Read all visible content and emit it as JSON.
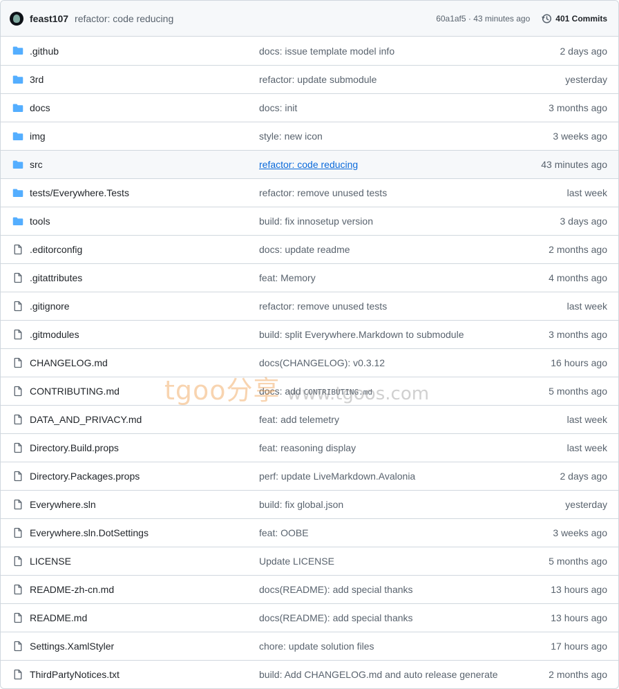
{
  "header": {
    "author": "feast107",
    "message": "refactor: code reducing",
    "meta": "60a1af5 · 43 minutes ago",
    "commits": "401 Commits"
  },
  "rows": [
    {
      "type": "folder",
      "name": ".github",
      "message": "docs: issue template model info",
      "time": "2 days ago"
    },
    {
      "type": "folder",
      "name": "3rd",
      "message": "refactor: update submodule",
      "time": "yesterday"
    },
    {
      "type": "folder",
      "name": "docs",
      "message": "docs: init",
      "time": "3 months ago"
    },
    {
      "type": "folder",
      "name": "img",
      "message": "style: new icon",
      "time": "3 weeks ago"
    },
    {
      "type": "folder",
      "name": "src",
      "message": "refactor: code reducing",
      "time": "43 minutes ago"
    },
    {
      "type": "folder",
      "name": "tests/Everywhere.Tests",
      "message": "refactor: remove unused tests",
      "time": "last week"
    },
    {
      "type": "folder",
      "name": "tools",
      "message": "build: fix innosetup version",
      "time": "3 days ago"
    },
    {
      "type": "file",
      "name": ".editorconfig",
      "message": "docs: update readme",
      "time": "2 months ago"
    },
    {
      "type": "file",
      "name": ".gitattributes",
      "message": "feat: Memory",
      "time": "4 months ago"
    },
    {
      "type": "file",
      "name": ".gitignore",
      "message": "refactor: remove unused tests",
      "time": "last week"
    },
    {
      "type": "file",
      "name": ".gitmodules",
      "message": "build: split Everywhere.Markdown to submodule",
      "time": "3 months ago"
    },
    {
      "type": "file",
      "name": "CHANGELOG.md",
      "message": "docs(CHANGELOG): v0.3.12",
      "time": "16 hours ago"
    },
    {
      "type": "file",
      "name": "CONTRIBUTING.md",
      "message": "docs: add",
      "code": "CONTRIBUTING.md",
      "time": "5 months ago"
    },
    {
      "type": "file",
      "name": "DATA_AND_PRIVACY.md",
      "message": "feat: add telemetry",
      "time": "last week"
    },
    {
      "type": "file",
      "name": "Directory.Build.props",
      "message": "feat: reasoning display",
      "time": "last week"
    },
    {
      "type": "file",
      "name": "Directory.Packages.props",
      "message": "perf: update LiveMarkdown.Avalonia",
      "time": "2 days ago"
    },
    {
      "type": "file",
      "name": "Everywhere.sln",
      "message": "build: fix global.json",
      "time": "yesterday"
    },
    {
      "type": "file",
      "name": "Everywhere.sln.DotSettings",
      "message": "feat: OOBE",
      "time": "3 weeks ago"
    },
    {
      "type": "file",
      "name": "LICENSE",
      "message": "Update LICENSE",
      "time": "5 months ago"
    },
    {
      "type": "file",
      "name": "README-zh-cn.md",
      "message": "docs(README): add special thanks",
      "time": "13 hours ago"
    },
    {
      "type": "file",
      "name": "README.md",
      "message": "docs(README): add special thanks",
      "time": "13 hours ago"
    },
    {
      "type": "file",
      "name": "Settings.XamlStyler",
      "message": "chore: update solution files",
      "time": "17 hours ago"
    },
    {
      "type": "file",
      "name": "ThirdPartyNotices.txt",
      "message": "build: Add CHANGELOG.md and auto release generate",
      "time": "2 months ago"
    }
  ],
  "watermark": {
    "brand": "tgoo分享",
    "url": "www.tgoos.com"
  },
  "colors": {
    "folder": "#54aeff",
    "file": "#59636e",
    "link": "#0969da",
    "border": "#d0d7de"
  }
}
